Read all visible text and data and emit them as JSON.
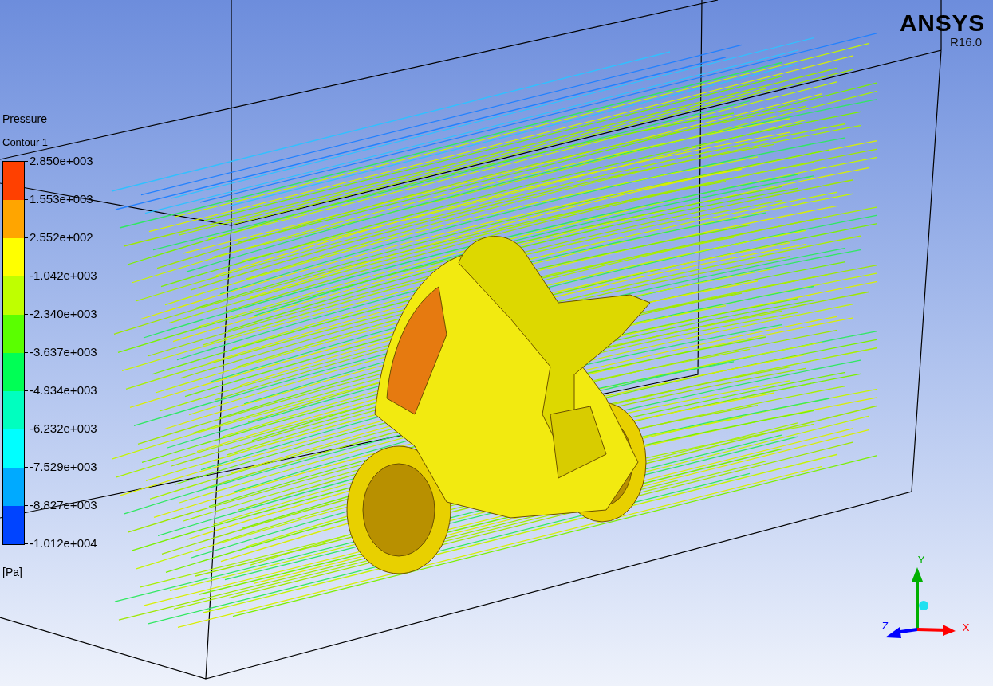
{
  "logo": {
    "brand": "ANSYS",
    "release": "R16.0"
  },
  "legend": {
    "variable": "Pressure",
    "object": "Contour 1",
    "unit": "[Pa]",
    "bands": [
      {
        "color": "#ff4000"
      },
      {
        "color": "#ffa500"
      },
      {
        "color": "#ffff00"
      },
      {
        "color": "#bfff00"
      },
      {
        "color": "#5aff00"
      },
      {
        "color": "#00ff55"
      },
      {
        "color": "#00ffbf"
      },
      {
        "color": "#00ffff"
      },
      {
        "color": "#00aaff"
      },
      {
        "color": "#0044ff"
      }
    ],
    "labels": [
      "2.850e+003",
      "1.553e+003",
      "2.552e+002",
      "-1.042e+003",
      "-2.340e+003",
      "-3.637e+003",
      "-4.934e+003",
      "-6.232e+003",
      "-7.529e+003",
      "-8.827e+003",
      "-1.012e+004"
    ]
  },
  "triad": [
    {
      "label": "Y",
      "color": "#00b000"
    },
    {
      "label": "Z",
      "color": "#0000ff"
    },
    {
      "label": "X",
      "color": "#ff0000"
    }
  ]
}
